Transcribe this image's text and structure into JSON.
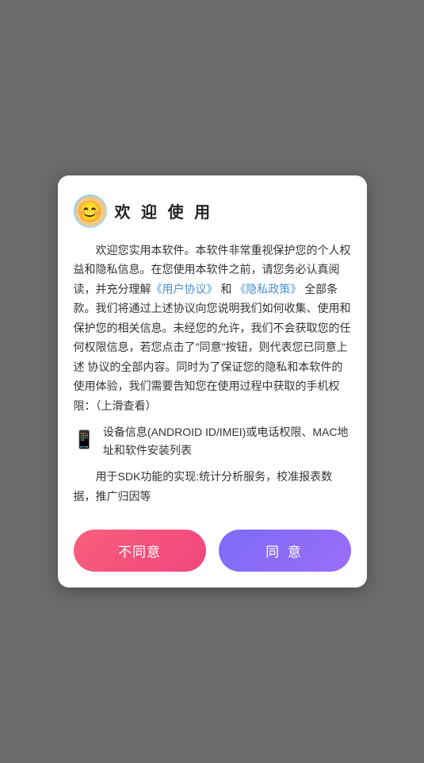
{
  "background_color": "#6b6b6b",
  "dialog": {
    "title": "欢 迎 使 用",
    "body_paragraphs": [
      "欢迎您实用本软件。本软件非常重视保护您的个人权益和隐私信息。在您使用本软件之前，请您务必认真阅读，并充分理解",
      "《用户协议》",
      "和",
      "《隐私政策》",
      "全部条款。我们将通过上述协议向您说明我们如何收集、使用和保护您的相关信息。未经您的允许，我们不会获取您的任何权限信息，若您点击了\"同意\"按钮，则代表您已同意上述 协议的全部内容。同时为了保证您的隐私和本软件的使用体验，我们需要告知您在使用过程中获取的手机权限：（上滑查看）"
    ],
    "device_info_label": "设备信息(ANDROID ID/IMEI)或电话权限、MAC地址和软件安装列表",
    "sdk_text": "用于SDK功能的实现:统计分析服务，校准报表数据，推广归因等",
    "btn_disagree": "不同意",
    "btn_agree": "同  意",
    "link_agreement": "《用户协议》",
    "link_privacy": "《隐私政策》"
  },
  "icons": {
    "avatar": "avatar-icon",
    "phone": "phone-icon"
  }
}
